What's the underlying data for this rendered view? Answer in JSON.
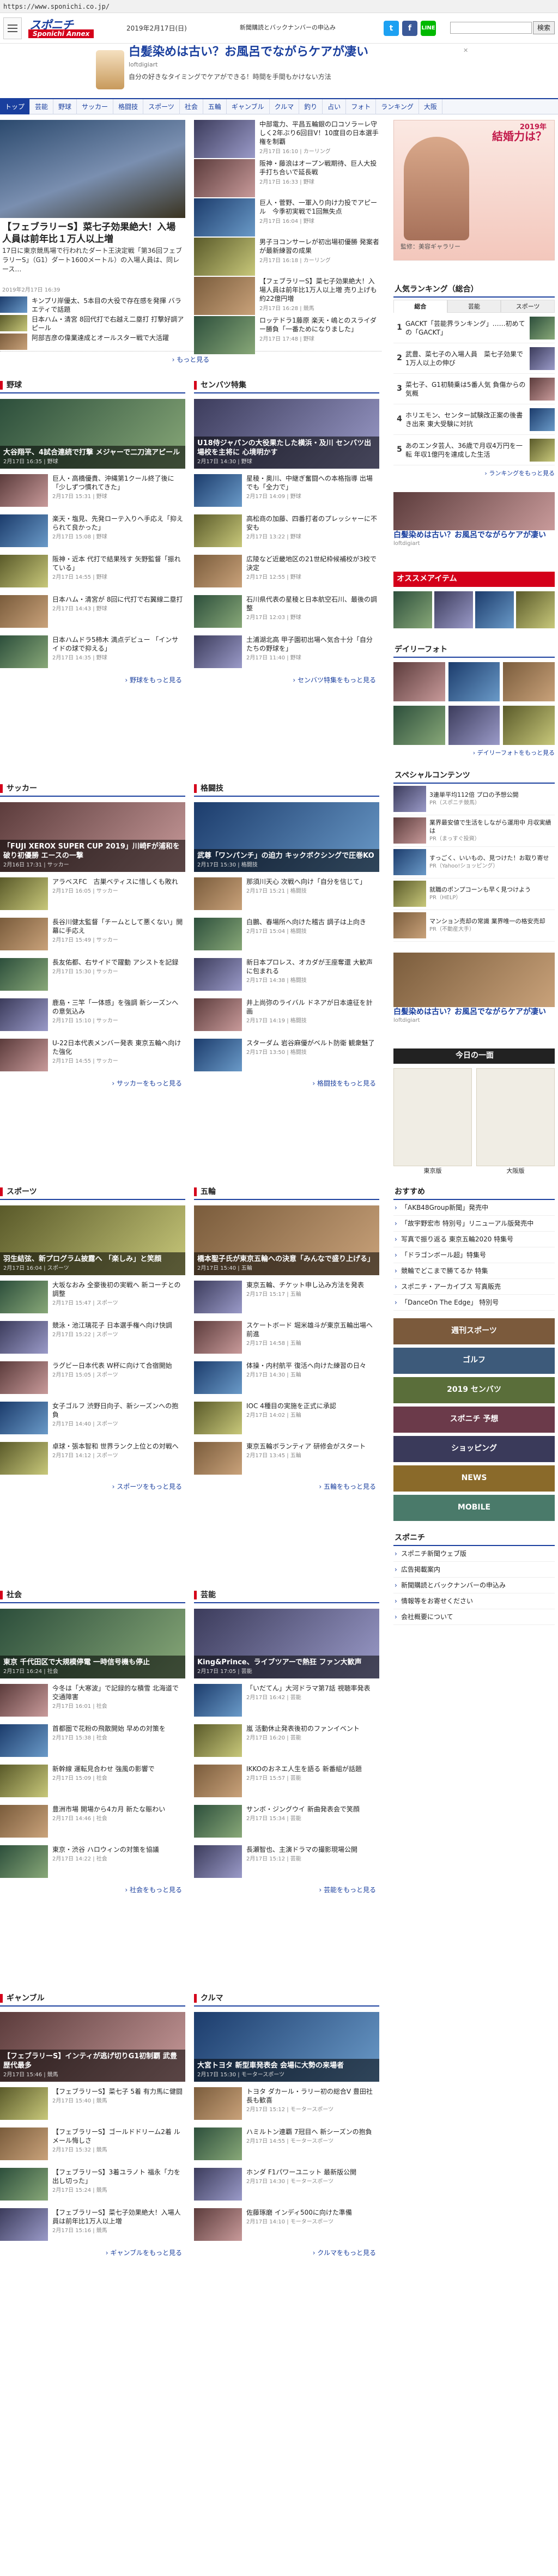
{
  "url": "https://www.sponichi.co.jp/",
  "header": {
    "logo_top": "スポニチ",
    "logo_bottom": "Sponichi Annex",
    "date": "2019年2月17日(日)",
    "links": [
      "新聞購読とバックナンバーの申込み"
    ],
    "search_btn": "検索"
  },
  "ad": {
    "title": "白髪染めは古い？お風呂でながらケアが凄い",
    "sponsor": "loftdigiart",
    "desc": "自分の好きなタイミングでケアができる！時間を手間もかけない方法"
  },
  "nav": [
    "トップ",
    "芸能",
    "野球",
    "サッカー",
    "格闘技",
    "スポーツ",
    "社会",
    "五輪",
    "ギャンブル",
    "クルマ",
    "釣り",
    "占い",
    "フォト",
    "ランキング",
    "大阪"
  ],
  "hero": {
    "title": "【フェブラリーS】菜七子効果絶大！入場人員は前年比１万人以上増",
    "text": "17日に東京競馬場で行われたダート王決定戦「第36回フェブラリーS」（G1）ダート1600メートル）の入場人員は、同レース…",
    "meta": "2019年2月17日 16:39"
  },
  "hero_right": [
    {
      "t": "中部電力、平昌五輪銀の口コソラーレ守しく2年ぶり6回目V！10度目の日本選手権を制覇",
      "m": "2月17日 16:10 | カーリング"
    },
    {
      "t": "阪神・藤浪はオープン戦期待、巨人大投手打ち合いで延長戦",
      "m": "2月17日 16:33 | 野球"
    },
    {
      "t": "巨人・菅野、一軍入り向け力投でアピール　今季初実戦で1回無失点",
      "m": "2月17日 16:04 | 野球"
    },
    {
      "t": "男子ヨコンサーレが初出場初優勝 発案者が最新練習の成果",
      "m": "2月17日 16:18 | カーリング"
    },
    {
      "t": "【フェブラリーS】菜七子効果絶大！入場人員は前年比1万人以上増 売り上げも約22億円増",
      "m": "2月17日 16:28 | 競馬"
    },
    {
      "t": "ロッテドラ1藤原 楽天・嶋とのスライダー勝負「一番ためになりました」",
      "m": "2月17日 17:48 | 野球"
    }
  ],
  "hero_left": [
    {
      "t": "キンプリ岸優太、5本目の大役で存在感を発揮 バラエティで話題",
      "m": "2月17日 15:44 | 芸能"
    },
    {
      "t": "日本ハム・清宮 8回代打で右越え二塁打 打撃好調アピール",
      "m": "2月17日 15:42 | 野球"
    },
    {
      "t": "阿部吉彦の偉業達成とオールスター戦で大活躍",
      "m": "2月17日 15:00 | 芸能"
    }
  ],
  "more_label": "もっと見る",
  "sections": [
    {
      "name": "野球",
      "img_cap": "大谷翔平、4試合連続で打撃 メジャーで二刀流アピール",
      "img_meta": "2月17日 16:35 | 野球",
      "items": [
        {
          "t": "巨人・高橋優貴、沖縄第1クール終了後に「少しずつ慣れてきた」",
          "m": "2月17日 15:31 | 野球"
        },
        {
          "t": "楽天・塩見、先発ローテ入りへ手応え「抑えられて良かった」",
          "m": "2月17日 15:08 | 野球"
        },
        {
          "t": "阪神・近本 代打で結果残す 矢野監督「振れている」",
          "m": "2月17日 14:55 | 野球"
        },
        {
          "t": "日本ハム・清宮が 8回に代打で右翼線二塁打",
          "m": "2月17日 14:43 | 野球"
        },
        {
          "t": "日本ハムドラ5柿木 満点デビュー 「インサイドの球で抑える」",
          "m": "2月17日 14:35 | 野球"
        }
      ],
      "more": "野球をもっと見る"
    },
    {
      "name": "センバツ特集",
      "img_cap": "U18侍ジャパンの大役果たした横浜・及川 センバツ出場校を主将に 心境明かす",
      "img_meta": "2月17日 14:30 | 野球",
      "items": [
        {
          "t": "星稜・奥川、中継ぎ奮闘への本格指導 出場でも「全力で」",
          "m": "2月17日 14:09 | 野球"
        },
        {
          "t": "高松商の加藤、四番打者のプレッシャーに不安も",
          "m": "2月17日 13:22 | 野球"
        },
        {
          "t": "広陵など近畿地区の21世紀枠候補校が3校で決定",
          "m": "2月17日 12:55 | 野球"
        },
        {
          "t": "石川県代表の星稜と日本航空石川、最後の調整",
          "m": "2月17日 12:03 | 野球"
        },
        {
          "t": "土浦湖北高 甲子園初出場へ気合十分「自分たちの野球を」",
          "m": "2月17日 11:40 | 野球"
        }
      ],
      "more": "センバツ特集をもっと見る"
    },
    {
      "name": "サッカー",
      "img_cap": "「FUJI XEROX SUPER CUP 2019」川崎Fが浦和を破り初優勝 エースの一撃",
      "img_meta": "2月16日 17:31 | サッカー",
      "items": [
        {
          "t": "アラベスFC　古巣ベティスに惜しくも敗れ",
          "m": "2月17日 16:05 | サッカー"
        },
        {
          "t": "長谷川健太監督「チームとして悪くない」開幕に手応え",
          "m": "2月17日 15:49 | サッカー"
        },
        {
          "t": "長友佑都、右サイドで躍動 アシストを記録",
          "m": "2月17日 15:30 | サッカー"
        },
        {
          "t": "鹿島・三竿「一体感」を強調 新シーズンへの意気込み",
          "m": "2月17日 15:10 | サッカー"
        },
        {
          "t": "U-22日本代表メンバー発表 東京五輪へ向けた強化",
          "m": "2月17日 14:55 | サッカー"
        }
      ],
      "more": "サッカーをもっと見る"
    },
    {
      "name": "格闘技",
      "img_cap": "武尊「ワンパンチ」の迫力 キックボクシングで圧巻KO",
      "img_meta": "2月17日 15:30 | 格闘技",
      "items": [
        {
          "t": "那須川天心 次戦へ向け「自分を信じて」",
          "m": "2月17日 15:21 | 格闘技"
        },
        {
          "t": "白鵬、春場所へ向けた稽古 調子は上向き",
          "m": "2月17日 15:04 | 格闘技"
        },
        {
          "t": "新日本プロレス、オカダが王座奪還 大歓声に包まれる",
          "m": "2月17日 14:38 | 格闘技"
        },
        {
          "t": "井上尚弥のライバル ドネアが日本遠征を計画",
          "m": "2月17日 14:19 | 格闘技"
        },
        {
          "t": "スターダム 岩谷麻優がベルト防衛 観衆魅了",
          "m": "2月17日 13:50 | 格闘技"
        }
      ],
      "more": "格闘技をもっと見る"
    },
    {
      "name": "スポーツ",
      "img_cap": "羽生結弦、新プログラム披露へ 「楽しみ」と笑顔",
      "img_meta": "2月17日 16:04 | スポーツ",
      "items": [
        {
          "t": "大坂なおみ 全豪後初の実戦へ 新コーチとの調整",
          "m": "2月17日 15:47 | スポーツ"
        },
        {
          "t": "競泳・池江璃花子 日本選手権へ向け快調",
          "m": "2月17日 15:22 | スポーツ"
        },
        {
          "t": "ラグビー日本代表 W杯に向けて合宿開始",
          "m": "2月17日 15:05 | スポーツ"
        },
        {
          "t": "女子ゴルフ 渋野日向子、新シーズンへの抱負",
          "m": "2月17日 14:40 | スポーツ"
        },
        {
          "t": "卓球・張本智和 世界ランク上位との対戦へ",
          "m": "2月17日 14:12 | スポーツ"
        }
      ],
      "more": "スポーツをもっと見る"
    },
    {
      "name": "五輪",
      "img_cap": "橋本聖子氏が東京五輪への決意「みんなで盛り上げる」",
      "img_meta": "2月17日 15:40 | 五輪",
      "items": [
        {
          "t": "東京五輪、チケット申し込み方法を発表",
          "m": "2月17日 15:17 | 五輪"
        },
        {
          "t": "スケートボード 堀米雄斗が東京五輪出場へ前進",
          "m": "2月17日 14:58 | 五輪"
        },
        {
          "t": "体操・内村航平 復活へ向けた練習の日々",
          "m": "2月17日 14:30 | 五輪"
        },
        {
          "t": "IOC 4種目の実施を正式に承認",
          "m": "2月17日 14:02 | 五輪"
        },
        {
          "t": "東京五輪ボランティア 研修会がスタート",
          "m": "2月17日 13:45 | 五輪"
        }
      ],
      "more": "五輪をもっと見る"
    },
    {
      "name": "社会",
      "img_cap": "東京 千代田区で大規模停電 一時信号機も停止",
      "img_meta": "2月17日 16:24 | 社会",
      "items": [
        {
          "t": "今冬は「大寒波」で記録的な積雪 北海道で交通障害",
          "m": "2月17日 16:01 | 社会"
        },
        {
          "t": "首都圏で花粉の飛散開始 早めの対策を",
          "m": "2月17日 15:38 | 社会"
        },
        {
          "t": "新幹線 運転見合わせ 強風の影響で",
          "m": "2月17日 15:09 | 社会"
        },
        {
          "t": "豊洲市場 開場から4カ月 新たな賑わい",
          "m": "2月17日 14:46 | 社会"
        },
        {
          "t": "東京・渋谷 ハロウィンの対策を協議",
          "m": "2月17日 14:22 | 社会"
        }
      ],
      "more": "社会をもっと見る"
    },
    {
      "name": "芸能",
      "img_cap": "King&Prince、ライブツアーで熱狂 ファン大歓声",
      "img_meta": "2月17日 17:05 | 芸能",
      "items": [
        {
          "t": "「いだてん」大河ドラマ第7話 視聴率発表",
          "m": "2月17日 16:42 | 芸能"
        },
        {
          "t": "嵐 活動休止発表後初のファンイベント",
          "m": "2月17日 16:20 | 芸能"
        },
        {
          "t": "IKKOのおネエ人生を語る 新番組が話題",
          "m": "2月17日 15:57 | 芸能"
        },
        {
          "t": "サンボ・ジングウイ 新曲発表会で笑顔",
          "m": "2月17日 15:34 | 芸能"
        },
        {
          "t": "長瀬智也、主演ドラマの撮影現場公開",
          "m": "2月17日 15:12 | 芸能"
        }
      ],
      "more": "芸能をもっと見る"
    },
    {
      "name": "ギャンブル",
      "img_cap": "【フェブラリーS】インティが逃げ切りG1初制覇 武豊 歴代最多",
      "img_meta": "2月17日 15:46 | 競馬",
      "items": [
        {
          "t": "【フェブラリーS】菜七子 5着 有力馬に健闘",
          "m": "2月17日 15:40 | 競馬"
        },
        {
          "t": "【フェブラリーS】ゴールドドリーム2着 ルメール悔しさ",
          "m": "2月17日 15:32 | 競馬"
        },
        {
          "t": "【フェブラリーS】3着ユラノト 福永「力を出し切った」",
          "m": "2月17日 15:24 | 競馬"
        },
        {
          "t": "【フェブラリーS】菜七子効果絶大！入場人員は前年比1万人以上増",
          "m": "2月17日 15:16 | 競馬"
        }
      ],
      "more": "ギャンブルをもっと見る"
    },
    {
      "name": "クルマ",
      "img_cap": "大宮トヨタ 新型車発表会 会場に大勢の来場者",
      "img_meta": "2月17日 15:30 | モータースポーツ",
      "items": [
        {
          "t": "トヨタ ダカール・ラリー初の総合V 豊田社長も歓喜",
          "m": "2月17日 15:12 | モータースポーツ"
        },
        {
          "t": "ハミルトン連覇 7冠目へ 新シーズンの抱負",
          "m": "2月17日 14:55 | モータースポーツ"
        },
        {
          "t": "ホンダ F1パワーユニット 最新版公開",
          "m": "2月17日 14:30 | モータースポーツ"
        },
        {
          "t": "佐藤琢磨 インディ500に向けた準備",
          "m": "2月17日 14:10 | モータースポーツ"
        }
      ],
      "more": "クルマをもっと見る"
    }
  ],
  "side": {
    "ad_title": "結婚力は？",
    "ad_year": "2019年",
    "ad_sub": "監修：美容ギャラリー",
    "ranking_title": "人気ランキング（総合）",
    "ranking_tabs": [
      "総合",
      "芸能",
      "スポーツ"
    ],
    "ranking": [
      {
        "t": "GACKT「芸能界ランキング」……初めての「GACKT」"
      },
      {
        "t": "武豊、菜七子の入場人員　菜七子効果で1万人以上の伸び"
      },
      {
        "t": "菜七子、G1初騎乗は5番人気 負傷からの気概"
      },
      {
        "t": "ホリエモン、センター試験改正案の後書き出来 東大受験に対抗"
      },
      {
        "t": "あのエンタ芸人、36歳で月収4万円を一転 年収1億円を達成した生活"
      }
    ],
    "ranking_more": "ランキングをもっと見る",
    "ad2_title": "白髪染めは古い？お風呂でながらケアが凄い",
    "ad2_sponsor": "loftdigiart",
    "shop_title": "オススメアイテム",
    "photo_title": "デイリーフォト",
    "photo_more": "デイリーフォトをもっと見る",
    "special_title": "スペシャルコンテンツ",
    "specials": [
      {
        "t": "3連単平均112倍 プロの予想公開",
        "m": "PR（スポニチ競馬）"
      },
      {
        "t": "業界最安値で生活をしながら運用中 月収実績は",
        "m": "PR（まっすぐ投資）"
      },
      {
        "t": "すっごく、いいもの、見つけた！お取り寄せ",
        "m": "PR（Yahoo!ショッピング）"
      },
      {
        "t": "就職のポンプコーンも早く見つけよう",
        "m": "PR（HELP）"
      },
      {
        "t": "マンション売却の常識 業界唯一の格安売却",
        "m": "PR（不動産大手）"
      }
    ],
    "ad3_title": "白髪染めは古い？お風呂でながらケアが凄い",
    "ad3_sponsor": "loftdigiart",
    "paper_title": "今日の一面",
    "papers": [
      "東京版",
      "大阪版"
    ],
    "osusume_title": "おすすめ",
    "osusume": [
      "「AKB48Group新聞」発売中",
      "「故宇野宏市 特別号」リニューアル版発売中",
      "写真で振り返る 東京五輪2020 特集号",
      "「ドラゴンボール超」特集号",
      "競輪でどこまで勝てるか 特集",
      "スポニチ・アーカイブス 写真販売",
      "「DanceOn The Edge」 特別号"
    ],
    "banner_texts": [
      "週刊スポーツ",
      "ゴルフ",
      "2019 センバツ",
      "スポニチ 予想",
      "ショッピング",
      "NEWS",
      "MOBILE"
    ],
    "sponichi_title": "スポニチ",
    "sponichi_links": [
      "スポニチ新聞ウェブ版",
      "広告掲載案内",
      "新聞購読とバックナンバーの申込み",
      "情報等をお寄せください",
      "会社概要について"
    ]
  }
}
